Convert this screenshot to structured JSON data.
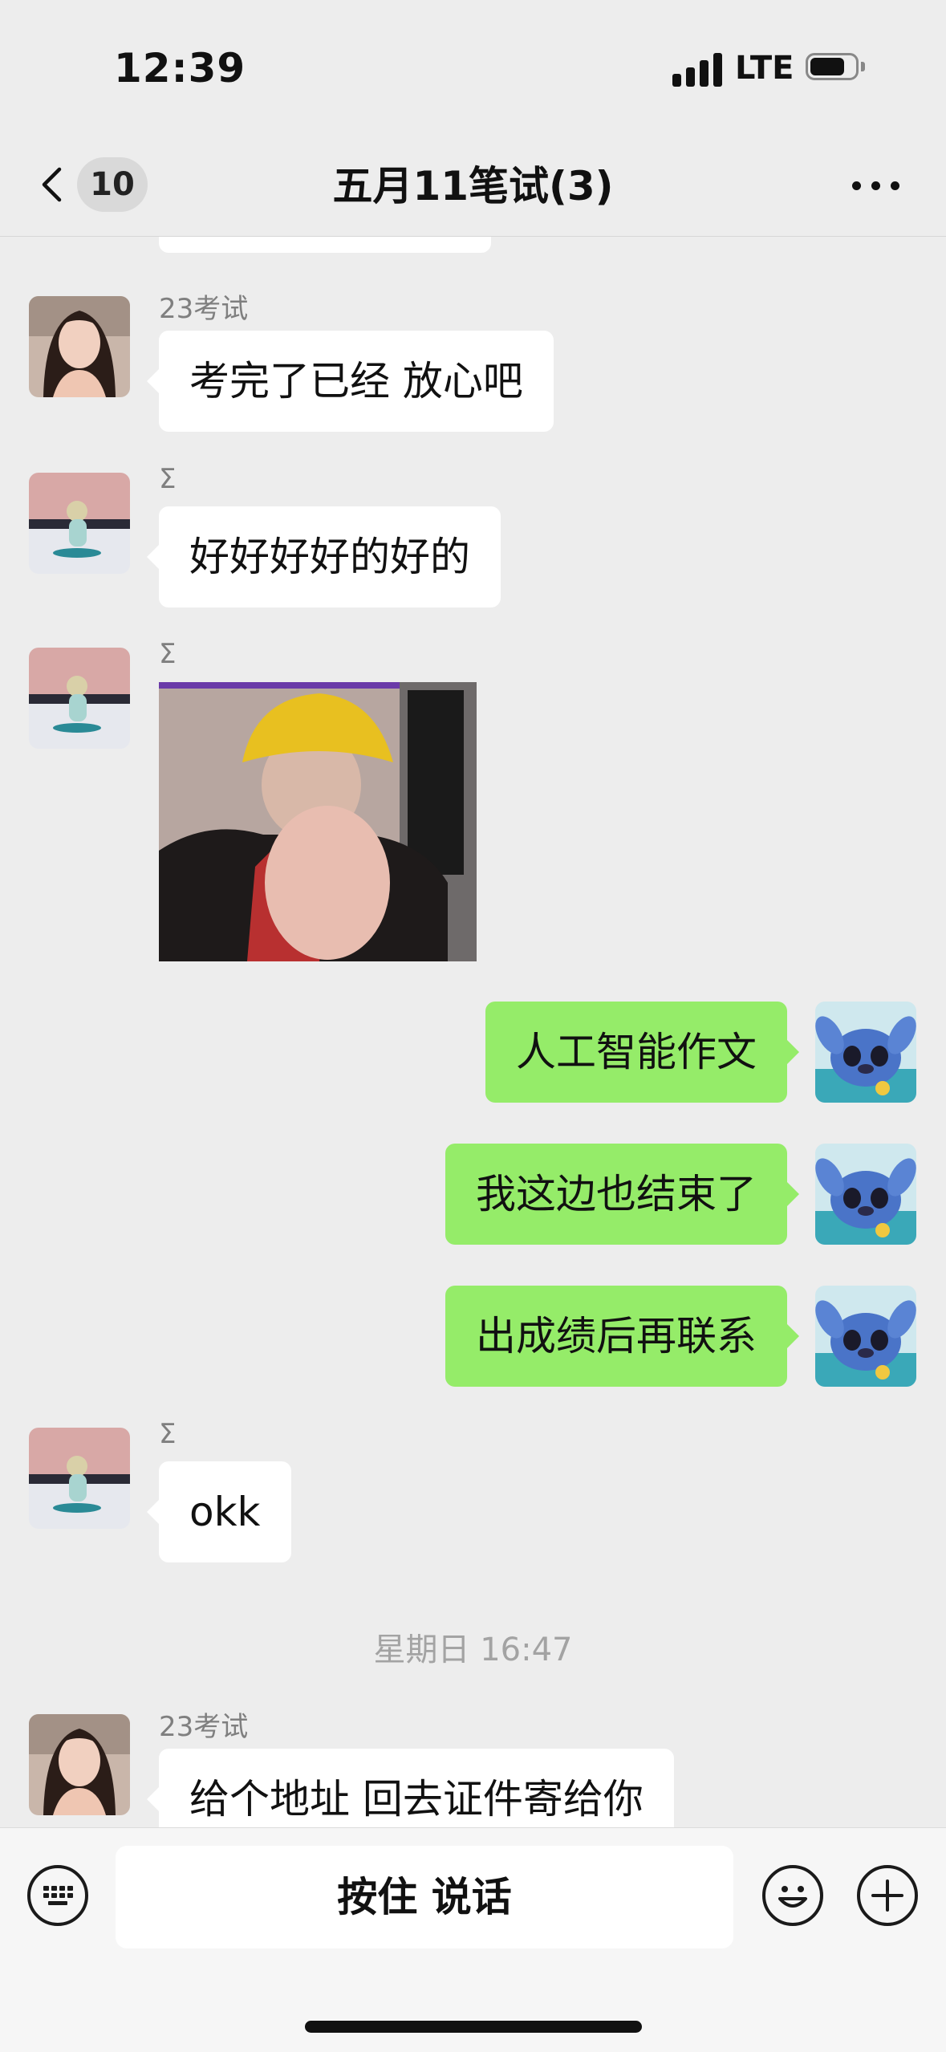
{
  "status_bar": {
    "time": "12:39",
    "network": "LTE"
  },
  "nav": {
    "unread_count": "10",
    "title": "五月11笔试(3)"
  },
  "messages": [
    {
      "direction": "in",
      "sender": "23考试",
      "avatar": "woman-avatar",
      "text": "考完了已经 放心吧"
    },
    {
      "direction": "in",
      "sender": "Σ",
      "avatar": "snowboard-avatar",
      "text": "好好好好的好的"
    },
    {
      "direction": "in",
      "sender": "Σ",
      "avatar": "snowboard-avatar",
      "type": "image",
      "image": "man-in-yellow-hat-photo"
    },
    {
      "direction": "out",
      "avatar": "stitch-avatar",
      "text": "人工智能作文"
    },
    {
      "direction": "out",
      "avatar": "stitch-avatar",
      "text": "我这边也结束了"
    },
    {
      "direction": "out",
      "avatar": "stitch-avatar",
      "text": "出成绩后再联系"
    },
    {
      "direction": "in",
      "sender": "Σ",
      "avatar": "snowboard-avatar",
      "text": "okk"
    },
    {
      "direction": "in",
      "sender": "23考试",
      "avatar": "woman-avatar",
      "text": "给个地址 回去证件寄给你"
    }
  ],
  "time_divider": "星期日 16:47",
  "input_bar": {
    "hold_to_talk": "按住 说话"
  },
  "colors": {
    "background": "#ededed",
    "outgoing_bubble": "#95ec69",
    "incoming_bubble": "#ffffff"
  }
}
